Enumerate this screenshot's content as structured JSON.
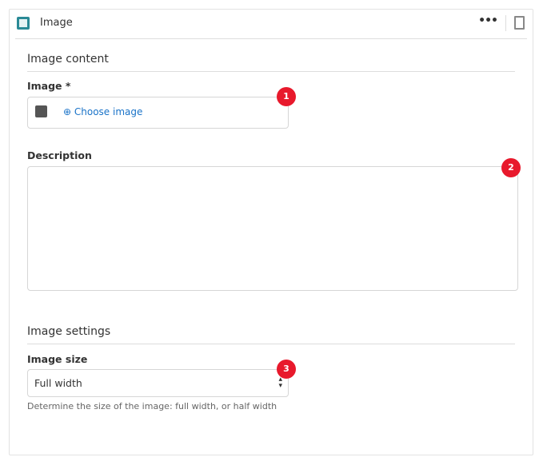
{
  "header": {
    "title": "Image",
    "more_icon": "more-icon",
    "delete_icon": "trash-icon"
  },
  "content": {
    "section": "Image content",
    "image_label": "Image *",
    "choose_label": "Choose image",
    "description_label": "Description",
    "description_value": ""
  },
  "settings": {
    "section": "Image settings",
    "size_label": "Image size",
    "size_value": "Full width",
    "help": "Determine the size of the image: full width, or half width"
  },
  "badges": [
    "1",
    "2",
    "3"
  ],
  "colors": {
    "accent": "#1a73c8",
    "badge": "#e8192c",
    "header_icon": "#2a8a96"
  }
}
